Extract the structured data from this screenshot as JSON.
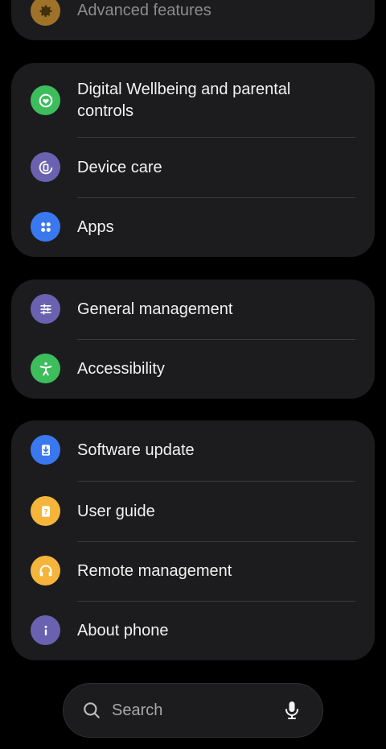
{
  "groups": [
    {
      "items": [
        {
          "label": "Advanced features",
          "icon": "gear-icon",
          "color": "#f0a830"
        }
      ]
    },
    {
      "items": [
        {
          "label": "Digital Wellbeing and parental controls",
          "icon": "heart-circle-icon",
          "color": "#3dbd5c"
        },
        {
          "label": "Device care",
          "icon": "device-care-icon",
          "color": "#6a62b0"
        },
        {
          "label": "Apps",
          "icon": "apps-grid-icon",
          "color": "#3a78f0"
        }
      ]
    },
    {
      "items": [
        {
          "label": "General management",
          "icon": "sliders-icon",
          "color": "#6a62b0"
        },
        {
          "label": "Accessibility",
          "icon": "accessibility-icon",
          "color": "#3dbd5c"
        }
      ]
    },
    {
      "items": [
        {
          "label": "Software update",
          "icon": "software-update-icon",
          "color": "#3a78f0"
        },
        {
          "label": "User guide",
          "icon": "user-guide-icon",
          "color": "#f5b53a"
        },
        {
          "label": "Remote management",
          "icon": "headset-icon",
          "color": "#f5b53a"
        },
        {
          "label": "About phone",
          "icon": "info-icon",
          "color": "#6a62b0"
        }
      ]
    }
  ],
  "search": {
    "placeholder": "Search",
    "search_icon": "search-icon",
    "mic_icon": "microphone-icon"
  }
}
